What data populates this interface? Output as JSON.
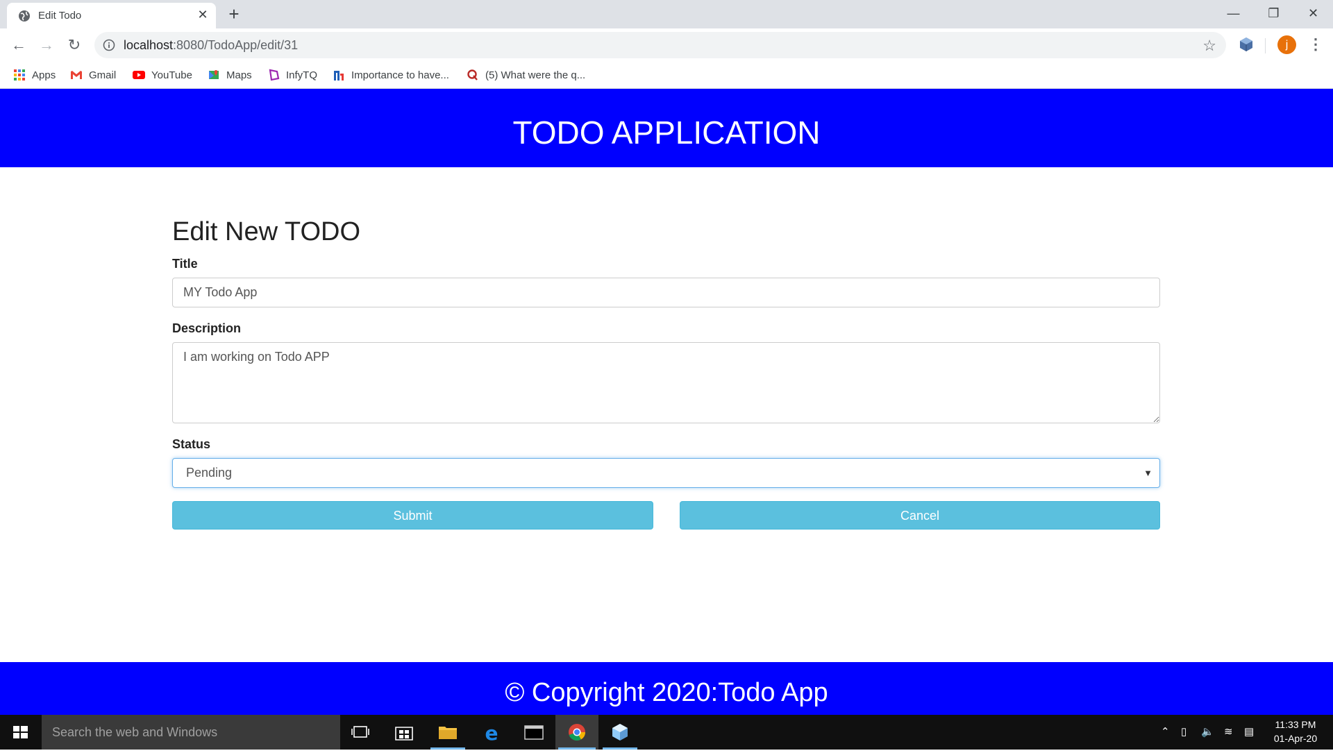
{
  "browser": {
    "tab_title": "Edit Todo",
    "tab_close": "✕",
    "new_tab": "+",
    "url_host": "localhost",
    "url_path": ":8080/TodoApp/edit/31",
    "profile_initial": "j",
    "window_controls": {
      "minimize": "—",
      "restore": "❐",
      "close": "✕"
    },
    "bookmarks": [
      {
        "label": "Apps",
        "icon": "apps-grid-icon"
      },
      {
        "label": "Gmail",
        "icon": "gmail-icon"
      },
      {
        "label": "YouTube",
        "icon": "youtube-icon"
      },
      {
        "label": "Maps",
        "icon": "maps-icon"
      },
      {
        "label": "InfyTQ",
        "icon": "infytq-icon"
      },
      {
        "label": "Importance to have...",
        "icon": "bookmark-n-icon"
      },
      {
        "label": "(5) What were the q...",
        "icon": "quora-icon"
      }
    ]
  },
  "page": {
    "app_title": "TODO APPLICATION",
    "form_heading": "Edit New TODO",
    "title_label": "Title",
    "title_value": "MY Todo App",
    "description_label": "Description",
    "description_value": "I am working on Todo APP",
    "status_label": "Status",
    "status_value": "Pending",
    "submit_label": "Submit",
    "cancel_label": "Cancel",
    "footer_text": "© Copyright 2020:Todo App"
  },
  "colors": {
    "header_bg": "#0000ff",
    "button_bg": "#5bc0de"
  },
  "taskbar": {
    "search_placeholder": "Search the web and Windows",
    "time": "11:33 PM",
    "date": "01-Apr-20"
  }
}
